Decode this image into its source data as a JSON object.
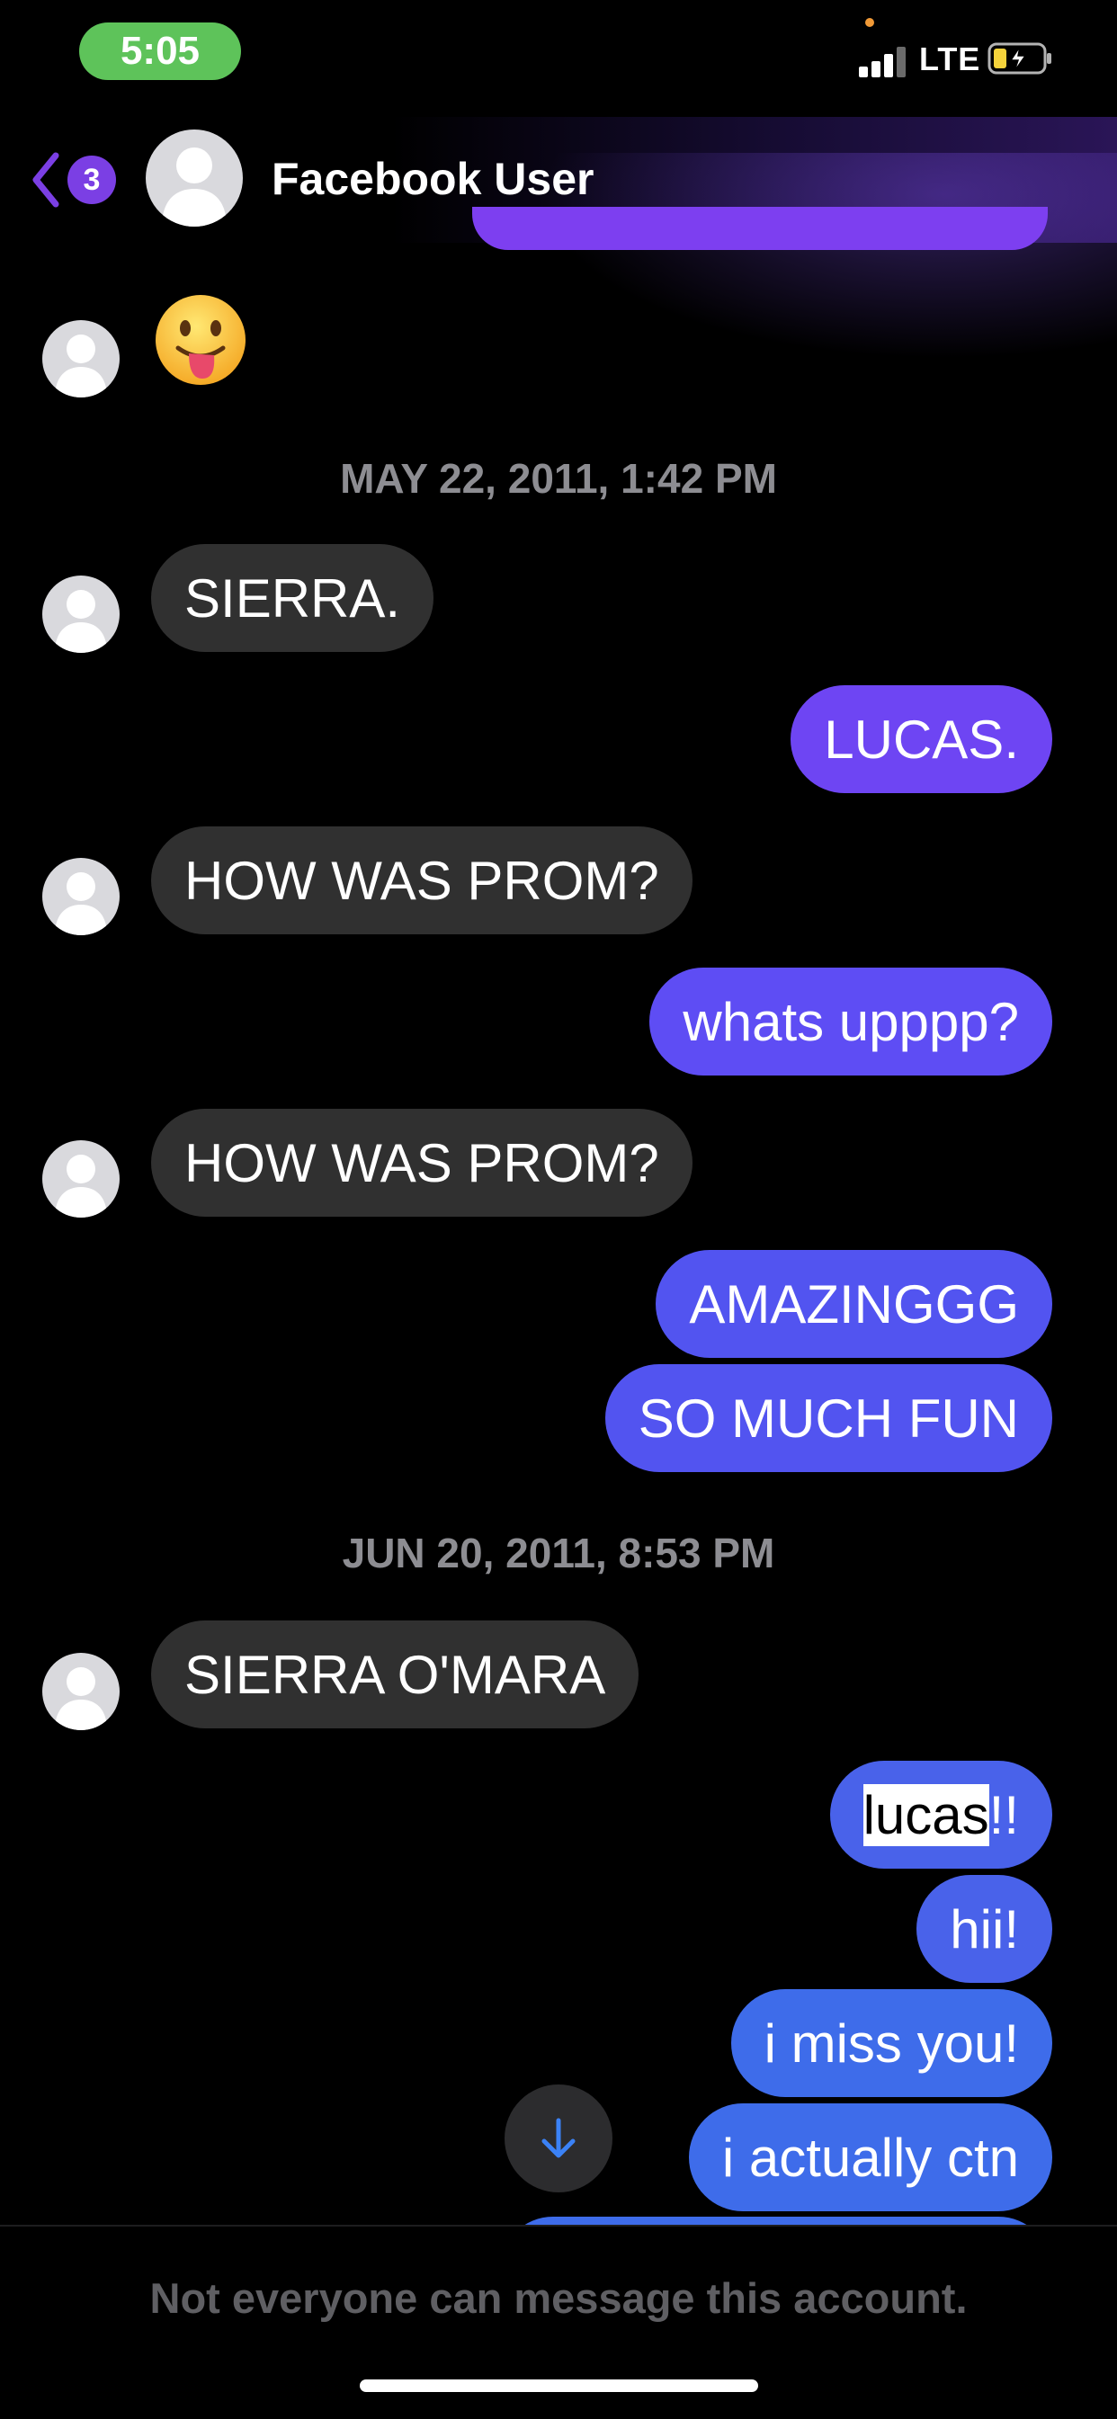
{
  "status_bar": {
    "time": "5:05",
    "network": "LTE",
    "battery_state": "charging",
    "colors": {
      "time_pill": "#5ec35a",
      "battery_fill": "#f5d33b"
    }
  },
  "header": {
    "back_badge_count": "3",
    "contact_name": "Facebook User",
    "avatar_icon": "person-silhouette-icon"
  },
  "conversation": {
    "emoji_message": "😛",
    "timestamps": [
      "MAY 22, 2011, 1:42 PM",
      "JUN 20, 2011, 8:53 PM"
    ],
    "messages": [
      {
        "from": "them",
        "text": "SIERRA."
      },
      {
        "from": "me",
        "text": "LUCAS."
      },
      {
        "from": "them",
        "text": "HOW WAS PROM?"
      },
      {
        "from": "me",
        "text": "whats upppp?"
      },
      {
        "from": "them",
        "text": "HOW WAS PROM?"
      },
      {
        "from": "me",
        "text": "AMAZINGGG"
      },
      {
        "from": "me",
        "text": "SO MUCH FUN"
      },
      {
        "from": "them",
        "text": "SIERRA O'MARA"
      },
      {
        "from": "me",
        "text_highlighted": "lucas",
        "text_rest": "!!"
      },
      {
        "from": "me",
        "text": "hii!"
      },
      {
        "from": "me",
        "text": "i miss you!"
      },
      {
        "from": "me",
        "text": "i actually ctn"
      }
    ],
    "colors": {
      "incoming_bubble": "#303030",
      "outgoing_gradient": [
        "#7d3ff0",
        "#6e45f3",
        "#5e4df4",
        "#5254f0",
        "#4962ea",
        "#3e6cea"
      ]
    }
  },
  "scroll_button": {
    "icon": "arrow-down-icon"
  },
  "footer": {
    "notice": "Not everyone can message this account."
  }
}
